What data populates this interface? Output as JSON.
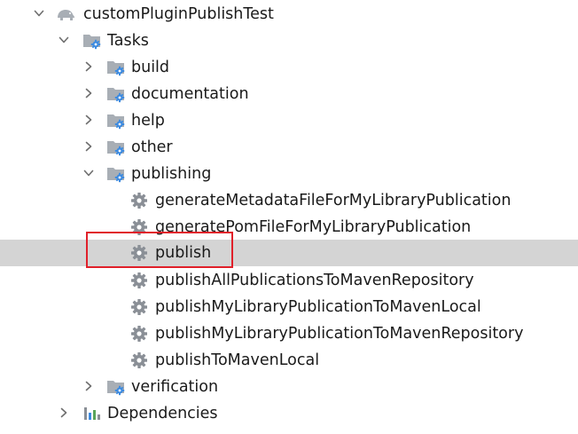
{
  "tree": {
    "root": {
      "label": "customPluginPublishTest",
      "icon": "elephant-icon"
    },
    "tasks": {
      "label": "Tasks",
      "icon": "folder-gear-icon"
    },
    "groups": {
      "build": "build",
      "documentation": "documentation",
      "help": "help",
      "other": "other",
      "publishing": "publishing",
      "verification": "verification"
    },
    "publishing_tasks": {
      "t0": "generateMetadataFileForMyLibraryPublication",
      "t1": "generatePomFileForMyLibraryPublication",
      "t2": "publish",
      "t3": "publishAllPublicationsToMavenRepository",
      "t4": "publishMyLibraryPublicationToMavenLocal",
      "t5": "publishMyLibraryPublicationToMavenRepository",
      "t6": "publishToMavenLocal"
    },
    "dependencies": {
      "label": "Dependencies",
      "icon": "bar-chart-icon"
    },
    "selected_task": "publish"
  },
  "colors": {
    "selection": "#d4d4d4",
    "highlight_box": "#e0202a",
    "gear": "#8a8f96",
    "folder": "#a8aeb5",
    "gear_badge": "#3d8be0"
  }
}
